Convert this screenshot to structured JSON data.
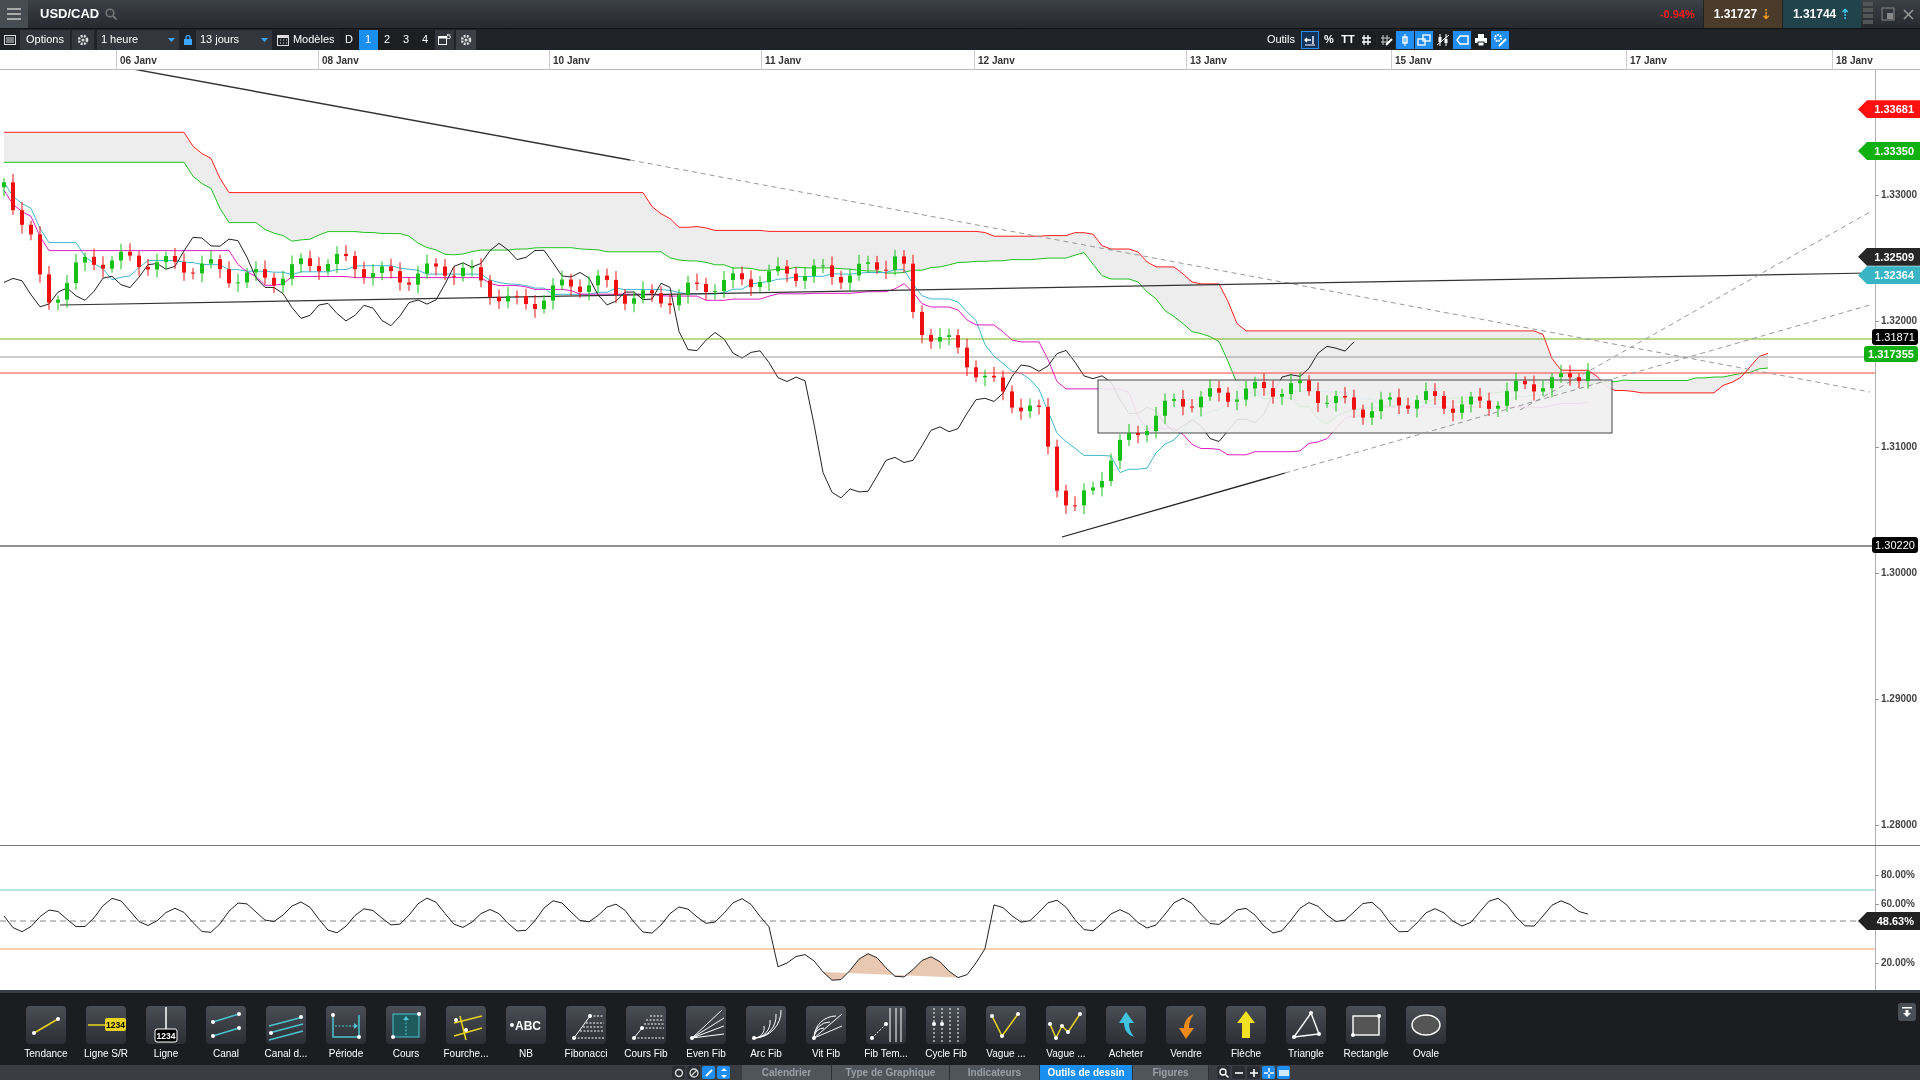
{
  "header": {
    "symbol": "USD/CAD",
    "change": "-0.94%",
    "quotes": [
      {
        "price": "1.31727",
        "arrow": "⇣",
        "color": "#f39a1e"
      },
      {
        "price": "1.31744",
        "arrow": "⇡",
        "color": "#39c7f0"
      }
    ]
  },
  "toolbar": {
    "options": "Options",
    "interval": "1 heure",
    "period": "13 jours",
    "models": "Modèles",
    "layouts": [
      {
        "label": "D",
        "selected": false
      },
      {
        "label": "1",
        "selected": true
      },
      {
        "label": "2",
        "selected": false
      },
      {
        "label": "3",
        "selected": false
      },
      {
        "label": "4",
        "selected": false
      }
    ],
    "window_count": "5",
    "tools_label": "Outils",
    "tools": [
      {
        "kind": "cursor",
        "on": false
      },
      {
        "kind": "percent",
        "label": "%",
        "on": false
      },
      {
        "kind": "text",
        "label": "TT",
        "on": false
      },
      {
        "kind": "grid",
        "on": false
      },
      {
        "kind": "draw",
        "on": false
      },
      {
        "kind": "candle",
        "on": true
      },
      {
        "kind": "compare",
        "on": true
      },
      {
        "kind": "indicator",
        "on": false
      },
      {
        "kind": "tag",
        "on": true
      },
      {
        "kind": "print",
        "on": false
      },
      {
        "kind": "settings",
        "on": true
      }
    ]
  },
  "date_axis": [
    "06 Janv",
    "08 Janv",
    "10 Janv",
    "11 Janv",
    "12 Janv",
    "13 Janv",
    "15 Janv",
    "17 Janv",
    "18 Janv"
  ],
  "price_axis": {
    "ticks": [
      "1.33000",
      "1.32000",
      "1.31000",
      "1.30000",
      "1.29000",
      "1.28000"
    ],
    "markers": [
      {
        "value": "1.33681",
        "kind": "tag",
        "color": "#ff1010"
      },
      {
        "value": "1.33350",
        "kind": "tag",
        "color": "#10b010"
      },
      {
        "value": "1.32509",
        "kind": "tag",
        "color": "#262626"
      },
      {
        "value": "1.32364",
        "kind": "tag",
        "color": "#38b4c4"
      },
      {
        "value": "1.31871",
        "kind": "box",
        "color": "#000000"
      },
      {
        "value": "1.317355",
        "kind": "box",
        "color": "#10b010"
      },
      {
        "value": "1.30220",
        "kind": "box",
        "color": "#000000"
      }
    ]
  },
  "rsi_axis": {
    "ticks": [
      "80.00%",
      "60.00%",
      "20.00%"
    ],
    "marker": "48.63%"
  },
  "drawing_tools": [
    {
      "kind": "trend",
      "label": "Tendance"
    },
    {
      "kind": "hline",
      "label": "Ligne S/R",
      "icon_text": "1234"
    },
    {
      "kind": "vline",
      "label": "Ligne",
      "icon_text": "1234"
    },
    {
      "kind": "channel",
      "label": "Canal"
    },
    {
      "kind": "lines",
      "label": "Canal d..."
    },
    {
      "kind": "period",
      "label": "Période"
    },
    {
      "kind": "range",
      "label": "Cours"
    },
    {
      "kind": "pitchfork",
      "label": "Fourche..."
    },
    {
      "kind": "text",
      "label": "NB",
      "icon_text": "ABC"
    },
    {
      "kind": "fib",
      "label": "Fibonacci"
    },
    {
      "kind": "fibprice",
      "label": "Cours Fib"
    },
    {
      "kind": "fan",
      "label": "Even Fib"
    },
    {
      "kind": "arc",
      "label": "Arc Fib"
    },
    {
      "kind": "speed",
      "label": "Vit Fib"
    },
    {
      "kind": "fibtime",
      "label": "Fib Tem..."
    },
    {
      "kind": "cycle",
      "label": "Cycle Fib"
    },
    {
      "kind": "wave",
      "label": "Vague ..."
    },
    {
      "kind": "zigzag",
      "label": "Vague ..."
    },
    {
      "kind": "buy",
      "label": "Acheter"
    },
    {
      "kind": "sell",
      "label": "Vendre"
    },
    {
      "kind": "arrow",
      "label": "Flèche"
    },
    {
      "kind": "triangle",
      "label": "Triangle"
    },
    {
      "kind": "rectangle",
      "label": "Rectangle"
    },
    {
      "kind": "oval",
      "label": "Ovale"
    }
  ],
  "bottom_tabs": [
    {
      "label": "Calendrier",
      "selected": false
    },
    {
      "label": "Type de Graphique",
      "selected": false
    },
    {
      "label": "Indicateurs",
      "selected": false
    },
    {
      "label": "Outils de dessin",
      "selected": true
    },
    {
      "label": "Figures",
      "selected": false
    }
  ]
}
